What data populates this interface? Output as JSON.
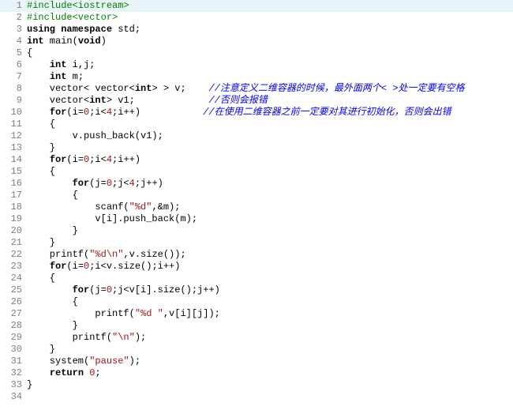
{
  "lines": [
    {
      "num": "1",
      "hl": true,
      "segments": [
        {
          "cls": "pp",
          "text": "#include<iostream>"
        }
      ]
    },
    {
      "num": "2",
      "hl": false,
      "segments": [
        {
          "cls": "pp",
          "text": "#include<vector>"
        }
      ]
    },
    {
      "num": "3",
      "hl": false,
      "segments": [
        {
          "cls": "kw",
          "text": "using namespace"
        },
        {
          "cls": "op",
          "text": " std;"
        }
      ]
    },
    {
      "num": "4",
      "hl": false,
      "segments": [
        {
          "cls": "kw",
          "text": "int"
        },
        {
          "cls": "op",
          "text": " main("
        },
        {
          "cls": "kw",
          "text": "void"
        },
        {
          "cls": "op",
          "text": ")"
        }
      ]
    },
    {
      "num": "5",
      "hl": false,
      "segments": [
        {
          "cls": "op",
          "text": "{"
        }
      ]
    },
    {
      "num": "6",
      "hl": false,
      "segments": [
        {
          "cls": "op",
          "text": "    "
        },
        {
          "cls": "kw",
          "text": "int"
        },
        {
          "cls": "op",
          "text": " i,j;"
        }
      ]
    },
    {
      "num": "7",
      "hl": false,
      "segments": [
        {
          "cls": "op",
          "text": "    "
        },
        {
          "cls": "kw",
          "text": "int"
        },
        {
          "cls": "op",
          "text": " m;"
        }
      ]
    },
    {
      "num": "8",
      "hl": false,
      "segments": [
        {
          "cls": "op",
          "text": "    vector< vector<"
        },
        {
          "cls": "kw",
          "text": "int"
        },
        {
          "cls": "op",
          "text": "> > v;    "
        },
        {
          "cls": "cm",
          "text": "//注意定义二维容器的时候，最外面两个< >处一定要有空格"
        }
      ]
    },
    {
      "num": "9",
      "hl": false,
      "segments": [
        {
          "cls": "op",
          "text": "    vector<"
        },
        {
          "cls": "kw",
          "text": "int"
        },
        {
          "cls": "op",
          "text": "> v1;             "
        },
        {
          "cls": "cm",
          "text": "//否则会报错"
        }
      ]
    },
    {
      "num": "10",
      "hl": false,
      "segments": [
        {
          "cls": "op",
          "text": "    "
        },
        {
          "cls": "kw",
          "text": "for"
        },
        {
          "cls": "op",
          "text": "(i="
        },
        {
          "cls": "num",
          "text": "0"
        },
        {
          "cls": "op",
          "text": ";i<"
        },
        {
          "cls": "num",
          "text": "4"
        },
        {
          "cls": "op",
          "text": ";i++)           "
        },
        {
          "cls": "cm",
          "text": "//在使用二维容器之前一定要对其进行初始化，否则会出错"
        }
      ]
    },
    {
      "num": "11",
      "hl": false,
      "segments": [
        {
          "cls": "op",
          "text": "    {"
        }
      ]
    },
    {
      "num": "12",
      "hl": false,
      "segments": [
        {
          "cls": "op",
          "text": "        v.push_back(v1);"
        }
      ]
    },
    {
      "num": "13",
      "hl": false,
      "segments": [
        {
          "cls": "op",
          "text": "    }"
        }
      ]
    },
    {
      "num": "14",
      "hl": false,
      "segments": [
        {
          "cls": "op",
          "text": "    "
        },
        {
          "cls": "kw",
          "text": "for"
        },
        {
          "cls": "op",
          "text": "(i="
        },
        {
          "cls": "num",
          "text": "0"
        },
        {
          "cls": "op",
          "text": ";i<"
        },
        {
          "cls": "num",
          "text": "4"
        },
        {
          "cls": "op",
          "text": ";i++)"
        }
      ]
    },
    {
      "num": "15",
      "hl": false,
      "segments": [
        {
          "cls": "op",
          "text": "    {"
        }
      ]
    },
    {
      "num": "16",
      "hl": false,
      "segments": [
        {
          "cls": "op",
          "text": "        "
        },
        {
          "cls": "kw",
          "text": "for"
        },
        {
          "cls": "op",
          "text": "(j="
        },
        {
          "cls": "num",
          "text": "0"
        },
        {
          "cls": "op",
          "text": ";j<"
        },
        {
          "cls": "num",
          "text": "4"
        },
        {
          "cls": "op",
          "text": ";j++)"
        }
      ]
    },
    {
      "num": "17",
      "hl": false,
      "segments": [
        {
          "cls": "op",
          "text": "        {"
        }
      ]
    },
    {
      "num": "18",
      "hl": false,
      "segments": [
        {
          "cls": "op",
          "text": "            scanf("
        },
        {
          "cls": "str",
          "text": "\"%d\""
        },
        {
          "cls": "op",
          "text": ",&m);"
        }
      ]
    },
    {
      "num": "19",
      "hl": false,
      "segments": [
        {
          "cls": "op",
          "text": "            v[i].push_back(m);"
        }
      ]
    },
    {
      "num": "20",
      "hl": false,
      "segments": [
        {
          "cls": "op",
          "text": "        }"
        }
      ]
    },
    {
      "num": "21",
      "hl": false,
      "segments": [
        {
          "cls": "op",
          "text": "    }"
        }
      ]
    },
    {
      "num": "22",
      "hl": false,
      "segments": [
        {
          "cls": "op",
          "text": "    printf("
        },
        {
          "cls": "str",
          "text": "\"%d\\n\""
        },
        {
          "cls": "op",
          "text": ",v.size());"
        }
      ]
    },
    {
      "num": "23",
      "hl": false,
      "segments": [
        {
          "cls": "op",
          "text": "    "
        },
        {
          "cls": "kw",
          "text": "for"
        },
        {
          "cls": "op",
          "text": "(i="
        },
        {
          "cls": "num",
          "text": "0"
        },
        {
          "cls": "op",
          "text": ";i<v.size();i++)"
        }
      ]
    },
    {
      "num": "24",
      "hl": false,
      "segments": [
        {
          "cls": "op",
          "text": "    {"
        }
      ]
    },
    {
      "num": "25",
      "hl": false,
      "segments": [
        {
          "cls": "op",
          "text": "        "
        },
        {
          "cls": "kw",
          "text": "for"
        },
        {
          "cls": "op",
          "text": "(j="
        },
        {
          "cls": "num",
          "text": "0"
        },
        {
          "cls": "op",
          "text": ";j<v[i].size();j++)"
        }
      ]
    },
    {
      "num": "26",
      "hl": false,
      "segments": [
        {
          "cls": "op",
          "text": "        {"
        }
      ]
    },
    {
      "num": "27",
      "hl": false,
      "segments": [
        {
          "cls": "op",
          "text": "            printf("
        },
        {
          "cls": "str",
          "text": "\"%d \""
        },
        {
          "cls": "op",
          "text": ",v[i][j]);"
        }
      ]
    },
    {
      "num": "28",
      "hl": false,
      "segments": [
        {
          "cls": "op",
          "text": "        }"
        }
      ]
    },
    {
      "num": "29",
      "hl": false,
      "segments": [
        {
          "cls": "op",
          "text": "        printf("
        },
        {
          "cls": "str",
          "text": "\"\\n\""
        },
        {
          "cls": "op",
          "text": ");"
        }
      ]
    },
    {
      "num": "30",
      "hl": false,
      "segments": [
        {
          "cls": "op",
          "text": "    }"
        }
      ]
    },
    {
      "num": "31",
      "hl": false,
      "segments": [
        {
          "cls": "op",
          "text": "    system("
        },
        {
          "cls": "str",
          "text": "\"pause\""
        },
        {
          "cls": "op",
          "text": ");"
        }
      ]
    },
    {
      "num": "32",
      "hl": false,
      "segments": [
        {
          "cls": "op",
          "text": "    "
        },
        {
          "cls": "kw",
          "text": "return"
        },
        {
          "cls": "op",
          "text": " "
        },
        {
          "cls": "num",
          "text": "0"
        },
        {
          "cls": "op",
          "text": ";"
        }
      ]
    },
    {
      "num": "33",
      "hl": false,
      "segments": [
        {
          "cls": "op",
          "text": "}"
        }
      ]
    },
    {
      "num": "34",
      "hl": false,
      "segments": [
        {
          "cls": "op",
          "text": ""
        }
      ]
    }
  ]
}
